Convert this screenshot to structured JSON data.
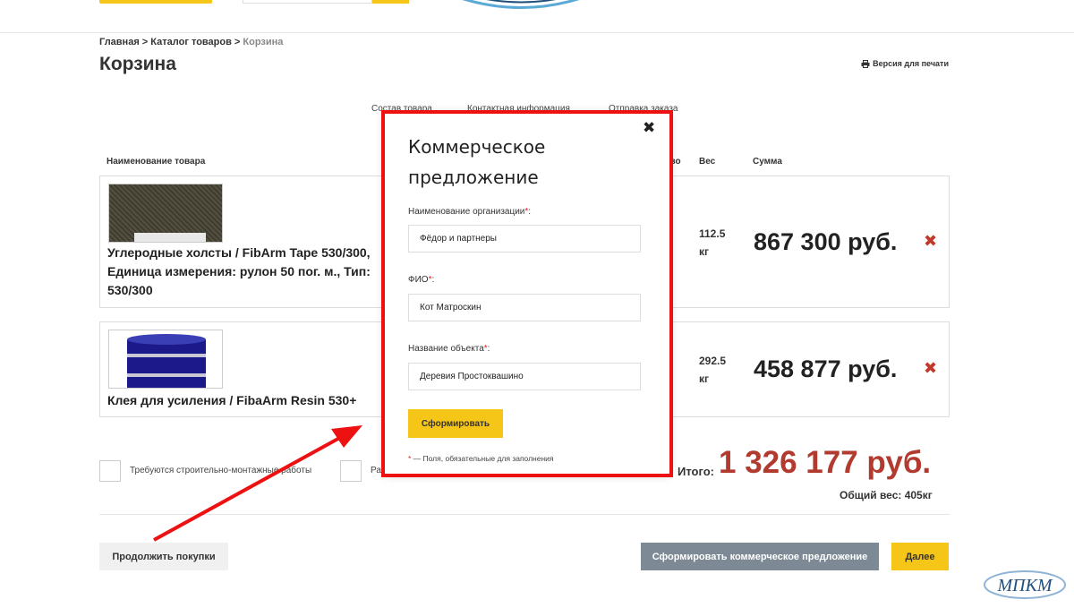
{
  "breadcrumb": {
    "home": "Главная",
    "sep1": " > ",
    "catalog": "Каталог товаров",
    "sep2": " > ",
    "current": "Корзина"
  },
  "page_title": "Корзина",
  "print_link": "Версия для печати",
  "steps": [
    "Состав товара",
    "Контактная информация",
    "Отправка заказа"
  ],
  "columns": {
    "name": "Наименование товара",
    "qty": "ство",
    "weight": "Вес",
    "sum": "Сумма"
  },
  "items": [
    {
      "name": "Углеродные холсты / FibArm Tape 530/300, Единица измерения: рулон 50 пог. м., Тип: 530/300",
      "weight_value": "112.5",
      "weight_unit": "кг",
      "price": "867 300 руб.",
      "remove": "✖",
      "qty_glyph": "❫"
    },
    {
      "name": "Клея для усиления / FibaArm Resin 530+",
      "weight_value": "292.5",
      "weight_unit": "кг",
      "price": "458 877 руб.",
      "remove": "✖",
      "qty_glyph": "❫"
    }
  ],
  "options": {
    "mounting": "Требуются строительно-монтажные работы",
    "second": "Ра"
  },
  "totals": {
    "label": "Итого:",
    "value": "1 326 177 руб.",
    "weight": "Общий вес: 405кг"
  },
  "buttons": {
    "continue": "Продолжить покупки",
    "offer": "Сформировать коммерческое предложение",
    "next": "Далее"
  },
  "modal": {
    "title": "Коммерческое предложение",
    "close": "✖",
    "fields": [
      {
        "label": "Наименование организации",
        "value": "Фёдор и партнеры"
      },
      {
        "label": "ФИО",
        "value": "Кот Матроскин"
      },
      {
        "label": "Название объекта",
        "value": "Деревия Простоквашино"
      }
    ],
    "required_mark": "*",
    "label_suffix": ":",
    "submit": "Сформировать",
    "note": " — Поля, обязательные для заполнения"
  },
  "watermark_text": "МПКМ",
  "colors": {
    "accent_yellow": "#f5c518",
    "total_red": "#b23a2e",
    "remove_red": "#c0392b",
    "highlight_frame": "#ee1111",
    "offer_button": "#7d8a95"
  }
}
